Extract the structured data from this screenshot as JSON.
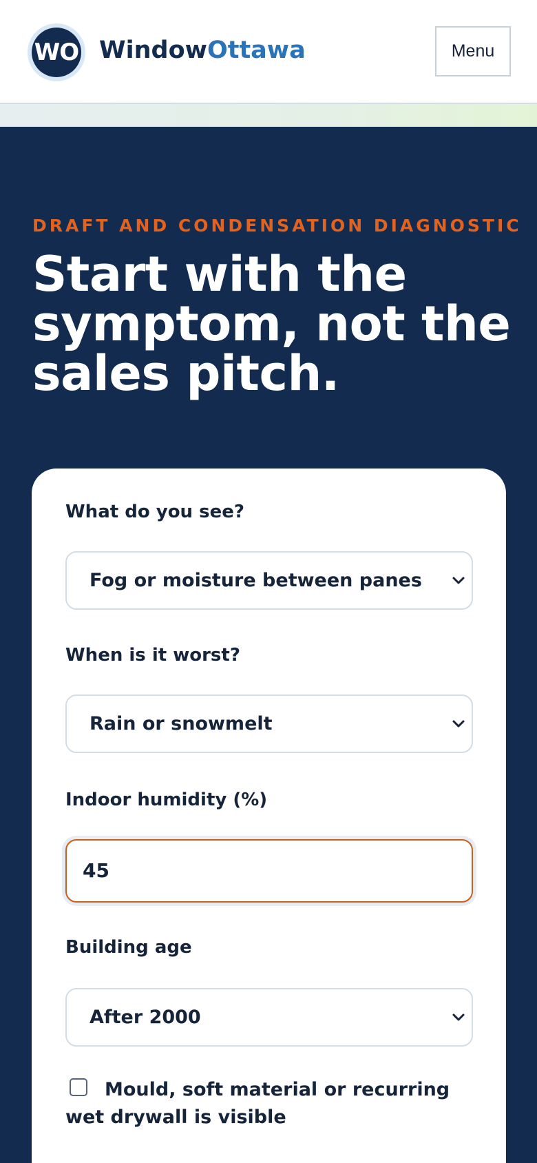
{
  "header": {
    "logo_initials": "WO",
    "brand_primary": "Window",
    "brand_accent": "Ottawa",
    "menu_label": "Menu"
  },
  "hero": {
    "eyebrow": "DRAFT AND CONDENSATION DIAGNOSTIC",
    "headline": "Start with the symptom, not the sales pitch."
  },
  "form": {
    "symptom": {
      "label": "What do you see?",
      "value": "Fog or moisture between panes"
    },
    "timing": {
      "label": "When is it worst?",
      "value": "Rain or snowmelt"
    },
    "humidity": {
      "label": "Indoor humidity (%)",
      "value": "45"
    },
    "building_age": {
      "label": "Building age",
      "value": "After 2000"
    },
    "mould": {
      "label": "Mould, soft material or recurring wet drywall is visible",
      "checked": false
    }
  },
  "colors": {
    "navy": "#122b4f",
    "brand_blue": "#2a73b8",
    "accent_orange": "#e2631f",
    "focus_border": "#c95f1f"
  }
}
